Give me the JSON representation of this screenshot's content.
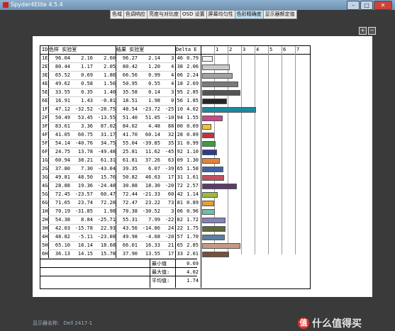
{
  "window": {
    "title": "Spyder4Elite 4.5.4",
    "minimize": "–",
    "maximize": "□",
    "close": "✕"
  },
  "tabs": [
    {
      "label": "色域",
      "active": false
    },
    {
      "label": "色调响应",
      "active": false
    },
    {
      "label": "亮度与对比度",
      "active": false
    },
    {
      "label": "OSD 设置",
      "active": false
    },
    {
      "label": "屏幕均匀性",
      "active": false
    },
    {
      "label": "色彩精确度",
      "active": true
    },
    {
      "label": "显示器额定值",
      "active": false
    }
  ],
  "toolbar": {
    "zoom_in_icon": "zoom-in-icon",
    "zoom_out_icon": "zoom-out-icon",
    "zoom_in": "+",
    "zoom_out": "−"
  },
  "chart_data": {
    "type": "table",
    "headers": {
      "id": "ID",
      "target": "色样 实验室",
      "result": "结果 实验室",
      "delta": "Delta E"
    },
    "axis_ticks": [
      "1",
      "2",
      "3",
      "4",
      "5",
      "6",
      "7"
    ],
    "axis_range": [
      0,
      7
    ],
    "rows": [
      {
        "id": "1E",
        "t": [
          "96.04",
          "2.16",
          "2.60"
        ],
        "r": [
          "96.27",
          "2.14",
          "3.46"
        ],
        "de": 0.79,
        "color": "#f5f5f5"
      },
      {
        "id": "2E",
        "t": [
          "80.44",
          "1.17",
          "2.05"
        ],
        "r": [
          "80.42",
          "1.20",
          "4.38"
        ],
        "de": 2.06,
        "color": "#c9c9c9"
      },
      {
        "id": "3E",
        "t": [
          "65.52",
          "0.69",
          "1.86"
        ],
        "r": [
          "66.56",
          "0.99",
          "4.06"
        ],
        "de": 2.24,
        "color": "#a2a2a2"
      },
      {
        "id": "4E",
        "t": [
          "49.62",
          "0.58",
          "1.56"
        ],
        "r": [
          "50.95",
          "0.55",
          "4.18"
        ],
        "de": 2.69,
        "color": "#7a7a7a"
      },
      {
        "id": "5E",
        "t": [
          "33.55",
          "0.35",
          "1.40"
        ],
        "r": [
          "35.58",
          "0.14",
          "3.95"
        ],
        "de": 2.85,
        "color": "#545454"
      },
      {
        "id": "6E",
        "t": [
          "16.91",
          "1.43",
          "-0.81"
        ],
        "r": [
          "18.51",
          "1.98",
          "0.56"
        ],
        "de": 1.85,
        "color": "#262626"
      },
      {
        "id": "1F",
        "t": [
          "47.12",
          "-32.52",
          "-28.75"
        ],
        "r": [
          "48.54",
          "-23.72",
          "-25.10"
        ],
        "de": 4.02,
        "color": "#1a8aa0"
      },
      {
        "id": "2F",
        "t": [
          "50.49",
          "53.45",
          "-13.55"
        ],
        "r": [
          "51.40",
          "51.05",
          "-10.94"
        ],
        "de": 1.55,
        "color": "#c54b8c"
      },
      {
        "id": "3F",
        "t": [
          "83.61",
          "3.36",
          "87.02"
        ],
        "r": [
          "84.02",
          "4.48",
          "88.00"
        ],
        "de": 0.69,
        "color": "#f0c42a"
      },
      {
        "id": "4F",
        "t": [
          "41.05",
          "60.75",
          "31.17"
        ],
        "r": [
          "41.70",
          "60.14",
          "32.28"
        ],
        "de": 0.89,
        "color": "#c2323c"
      },
      {
        "id": "5F",
        "t": [
          "54.14",
          "-40.76",
          "34.75"
        ],
        "r": [
          "55.04",
          "-39.85",
          "35.31"
        ],
        "de": 0.99,
        "color": "#3e9a45"
      },
      {
        "id": "6F",
        "t": [
          "24.75",
          "13.78",
          "-49.48"
        ],
        "r": [
          "25.81",
          "11.62",
          "-45.92"
        ],
        "de": 1.1,
        "color": "#2e3c8e"
      },
      {
        "id": "1G",
        "t": [
          "60.94",
          "38.21",
          "61.31"
        ],
        "r": [
          "61.81",
          "37.26",
          "63.09"
        ],
        "de": 1.3,
        "color": "#e0823c"
      },
      {
        "id": "2G",
        "t": [
          "37.80",
          "7.30",
          "-43.04"
        ],
        "r": [
          "39.35",
          "6.07",
          "-39.65"
        ],
        "de": 1.58,
        "color": "#3f62a6"
      },
      {
        "id": "3G",
        "t": [
          "49.81",
          "48.50",
          "15.76"
        ],
        "r": [
          "50.82",
          "46.63",
          "17.31"
        ],
        "de": 1.61,
        "color": "#c2505f"
      },
      {
        "id": "4G",
        "t": [
          "28.88",
          "19.36",
          "-24.48"
        ],
        "r": [
          "30.88",
          "18.30",
          "-20.72"
        ],
        "de": 2.57,
        "color": "#5a3c6a"
      },
      {
        "id": "5G",
        "t": [
          "72.45",
          "-23.57",
          "60.47"
        ],
        "r": [
          "72.44",
          "-21.33",
          "60.42"
        ],
        "de": 1.14,
        "color": "#9cbb3e"
      },
      {
        "id": "6G",
        "t": [
          "71.65",
          "23.74",
          "72.28"
        ],
        "r": [
          "72.47",
          "23.22",
          "73.81"
        ],
        "de": 0.89,
        "color": "#e3a22c"
      },
      {
        "id": "1H",
        "t": [
          "70.19",
          "-31.85",
          "1.98"
        ],
        "r": [
          "70.38",
          "-30.52",
          "3.06"
        ],
        "de": 0.96,
        "color": "#6ebfa8"
      },
      {
        "id": "2H",
        "t": [
          "54.38",
          "8.84",
          "-25.71"
        ],
        "r": [
          "55.31",
          "7.99",
          "-22.82"
        ],
        "de": 1.72,
        "color": "#8583b6"
      },
      {
        "id": "3H",
        "t": [
          "42.03",
          "-15.78",
          "22.93"
        ],
        "r": [
          "43.56",
          "-14.86",
          "24.22"
        ],
        "de": 1.75,
        "color": "#5c6a3e"
      },
      {
        "id": "4H",
        "t": [
          "48.82",
          "-5.11",
          "-23.08"
        ],
        "r": [
          "49.98",
          "-4.68",
          "-20.57"
        ],
        "de": 1.7,
        "color": "#5b7fa0"
      },
      {
        "id": "5H",
        "t": [
          "65.10",
          "18.14",
          "18.68"
        ],
        "r": [
          "66.01",
          "16.33",
          "21.65"
        ],
        "de": 2.85,
        "color": "#c49a85"
      },
      {
        "id": "6H",
        "t": [
          "36.13",
          "14.15",
          "15.78"
        ],
        "r": [
          "37.90",
          "13.55",
          "17.33"
        ],
        "de": 2.01,
        "color": "#73513d"
      }
    ],
    "summary": [
      {
        "label": "最小值",
        "value": "0.69"
      },
      {
        "label": "最大值:",
        "value": "4.02"
      },
      {
        "label": "平均值:",
        "value": "1.74"
      }
    ]
  },
  "footer": {
    "label": "显示器名称:",
    "value": "Dell 2417-1"
  },
  "watermark": {
    "badge": "值",
    "text": "什么值得买"
  }
}
